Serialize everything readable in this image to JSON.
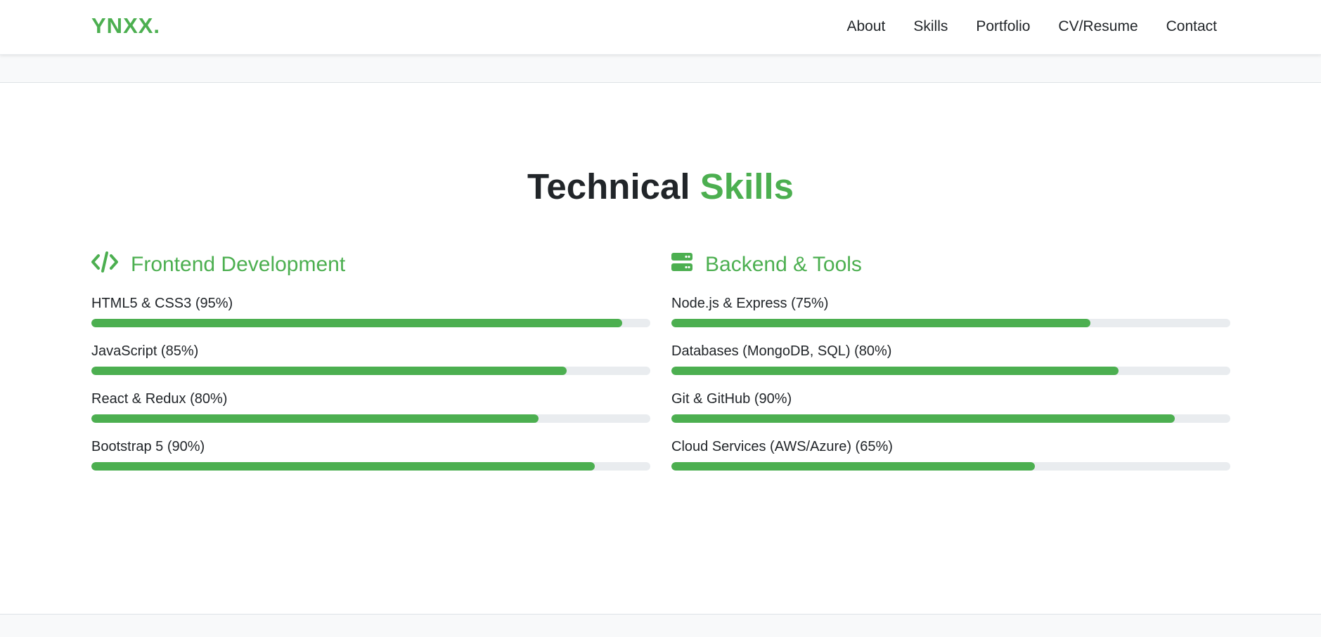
{
  "brand": "YNXX.",
  "nav": [
    "About",
    "Skills",
    "Portfolio",
    "CV/Resume",
    "Contact"
  ],
  "section": {
    "title_main": "Technical",
    "title_accent": "Skills"
  },
  "columns": [
    {
      "heading": "Frontend Development",
      "icon": "code-icon",
      "skills": [
        {
          "label": "HTML5 & CSS3 (95%)",
          "percent": 95
        },
        {
          "label": "JavaScript (85%)",
          "percent": 85
        },
        {
          "label": "React & Redux (80%)",
          "percent": 80
        },
        {
          "label": "Bootstrap 5 (90%)",
          "percent": 90
        }
      ]
    },
    {
      "heading": "Backend & Tools",
      "icon": "server-icon",
      "skills": [
        {
          "label": "Node.js & Express (75%)",
          "percent": 75
        },
        {
          "label": "Databases (MongoDB, SQL) (80%)",
          "percent": 80
        },
        {
          "label": "Git & GitHub (90%)",
          "percent": 90
        },
        {
          "label": "Cloud Services (AWS/Azure) (65%)",
          "percent": 65
        }
      ]
    }
  ],
  "colors": {
    "accent": "#4caf50",
    "track": "#e9ecef",
    "text": "#212529"
  }
}
